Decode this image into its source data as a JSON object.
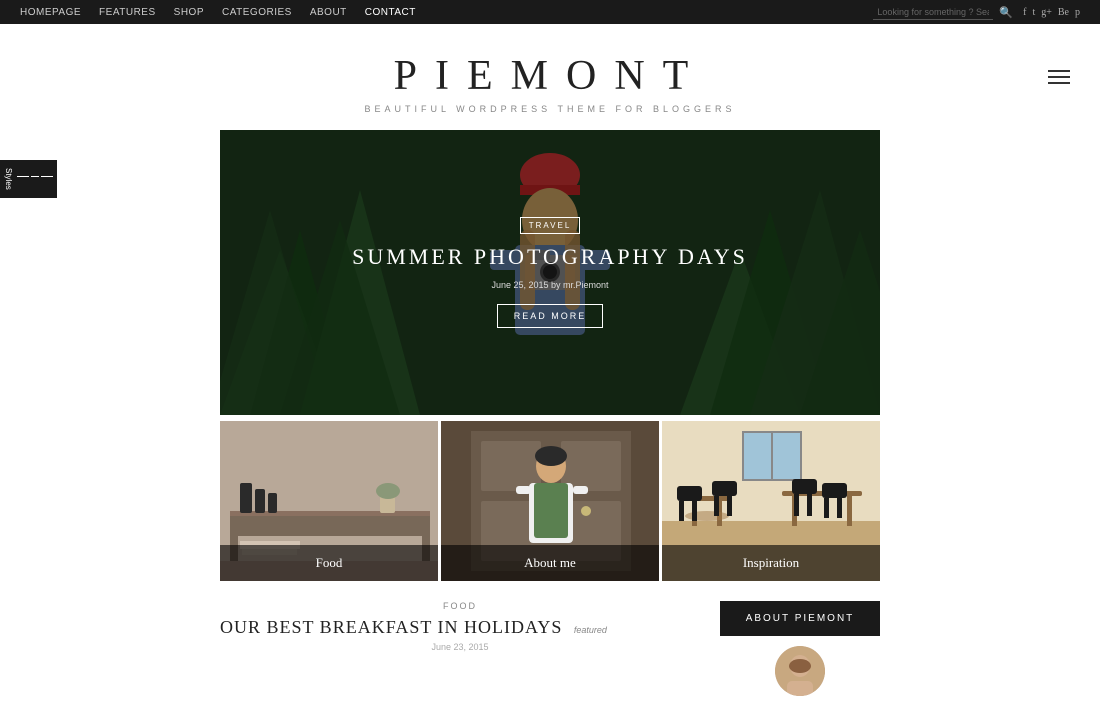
{
  "topnav": {
    "links": [
      {
        "label": "HOMEPAGE",
        "active": false
      },
      {
        "label": "FEATURES",
        "active": false
      },
      {
        "label": "SHOP",
        "active": false
      },
      {
        "label": "CATEGORIES",
        "active": false
      },
      {
        "label": "ABOUT",
        "active": false
      },
      {
        "label": "CONTACT",
        "active": true
      }
    ],
    "search_placeholder": "Looking for something ? Search away!",
    "social": [
      "f",
      "t",
      "g+",
      "Be",
      "p"
    ]
  },
  "header": {
    "logo": "PIEMONT",
    "tagline": "BEAUTIFUL  WORDPRESS THEME FOR BLOGGERS",
    "menu_icon_label": "≡"
  },
  "styles_button": {
    "label": "Styles"
  },
  "hero": {
    "category": "TRAVEL",
    "title": "SUMMER PHOTOGRAPHY DAYS",
    "date": "June 25, 2015 by mr.Piemont",
    "read_more": "READ MORE"
  },
  "grid": {
    "items": [
      {
        "label": "Food"
      },
      {
        "label": "About me"
      },
      {
        "label": "Inspiration"
      }
    ]
  },
  "blog": {
    "category_link": "FOOD",
    "title": "OUR BEST BREAKFAST IN HOLIDAYS",
    "featured_badge": "featured",
    "date": "June 23, 2015",
    "about_btn": "ABOUT PIEMONT"
  }
}
